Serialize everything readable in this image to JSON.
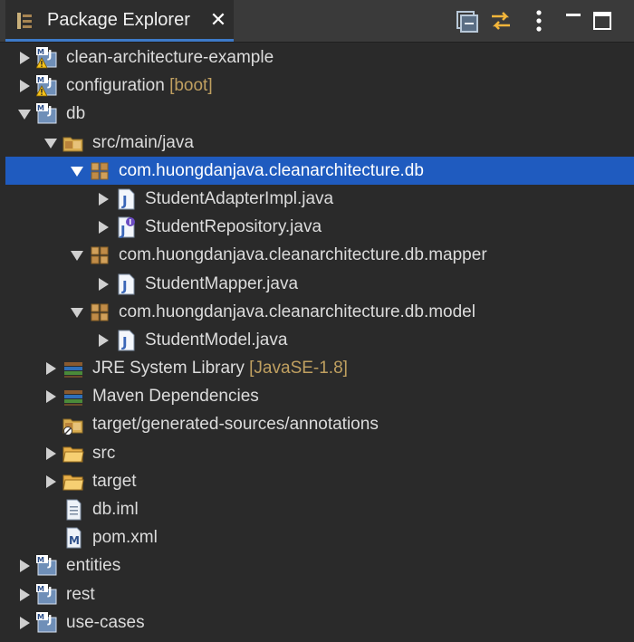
{
  "tab": {
    "title": "Package Explorer",
    "close_glyph": "✕",
    "icon": "package-explorer-icon"
  },
  "toolbar": {
    "buttons": [
      {
        "name": "collapse-all-icon"
      },
      {
        "name": "link-with-editor-icon"
      },
      {
        "name": "view-menu-icon"
      },
      {
        "name": "minimize-icon"
      },
      {
        "name": "maximize-icon"
      }
    ]
  },
  "tree": {
    "rows": [
      {
        "label": "clean-architecture-example",
        "deco": "",
        "icon": "maven-project-warning-icon",
        "expander": "collapsed",
        "depth": 0
      },
      {
        "label": "configuration",
        "deco": "[boot]",
        "icon": "maven-project-warning-icon",
        "expander": "collapsed",
        "depth": 0
      },
      {
        "label": "db",
        "deco": "",
        "icon": "maven-project-icon",
        "expander": "expanded",
        "depth": 0
      },
      {
        "label": "src/main/java",
        "deco": "",
        "icon": "source-folder-icon",
        "expander": "expanded",
        "depth": 1
      },
      {
        "label": "com.huongdanjava.cleanarchitecture.db",
        "deco": "",
        "icon": "package-icon",
        "expander": "expanded",
        "depth": 2,
        "selected": true
      },
      {
        "label": "StudentAdapterImpl.java",
        "deco": "",
        "icon": "java-file-icon",
        "expander": "collapsed",
        "depth": 3
      },
      {
        "label": "StudentRepository.java",
        "deco": "",
        "icon": "java-interface-file-icon",
        "expander": "collapsed",
        "depth": 3
      },
      {
        "label": "com.huongdanjava.cleanarchitecture.db.mapper",
        "deco": "",
        "icon": "package-icon",
        "expander": "expanded",
        "depth": 2
      },
      {
        "label": "StudentMapper.java",
        "deco": "",
        "icon": "java-file-icon",
        "expander": "collapsed",
        "depth": 3
      },
      {
        "label": "com.huongdanjava.cleanarchitecture.db.model",
        "deco": "",
        "icon": "package-icon",
        "expander": "expanded",
        "depth": 2
      },
      {
        "label": "StudentModel.java",
        "deco": "",
        "icon": "java-file-icon",
        "expander": "collapsed",
        "depth": 3
      },
      {
        "label": "JRE System Library",
        "deco": "[JavaSE-1.8]",
        "icon": "library-icon",
        "expander": "collapsed",
        "depth": 1
      },
      {
        "label": "Maven Dependencies",
        "deco": "",
        "icon": "library-icon",
        "expander": "collapsed",
        "depth": 1
      },
      {
        "label": "target/generated-sources/annotations",
        "deco": "",
        "icon": "generated-source-folder-icon",
        "expander": "none",
        "depth": 1
      },
      {
        "label": "src",
        "deco": "",
        "icon": "folder-icon",
        "expander": "collapsed",
        "depth": 1
      },
      {
        "label": "target",
        "deco": "",
        "icon": "folder-icon",
        "expander": "collapsed",
        "depth": 1
      },
      {
        "label": "db.iml",
        "deco": "",
        "icon": "text-file-icon",
        "expander": "none",
        "depth": 1
      },
      {
        "label": "pom.xml",
        "deco": "",
        "icon": "maven-pom-icon",
        "expander": "none",
        "depth": 1
      },
      {
        "label": "entities",
        "deco": "",
        "icon": "maven-project-icon",
        "expander": "collapsed",
        "depth": 0
      },
      {
        "label": "rest",
        "deco": "",
        "icon": "maven-project-icon",
        "expander": "collapsed",
        "depth": 0
      },
      {
        "label": "use-cases",
        "deco": "",
        "icon": "maven-project-icon",
        "expander": "collapsed",
        "depth": 0
      }
    ]
  },
  "colors": {
    "selection": "#1f5bbf",
    "tab_underline": "#3d7ac9",
    "decoration": "#c0a060"
  }
}
